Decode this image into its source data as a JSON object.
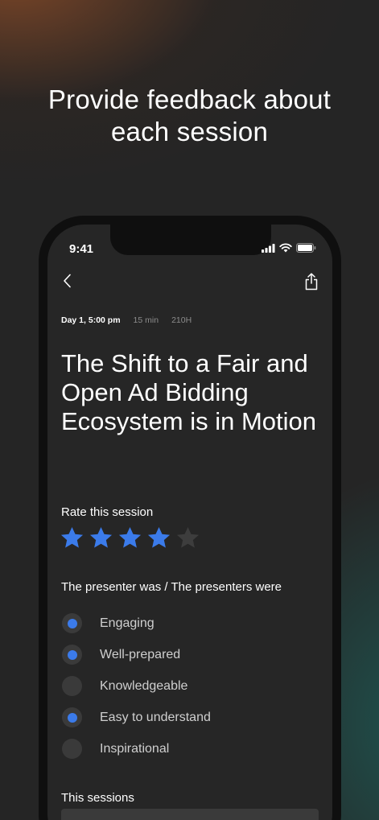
{
  "headline": {
    "line1": "Provide feedback about",
    "line2": "each session"
  },
  "status_bar": {
    "time": "9:41",
    "icons": [
      "cellular-signal-icon",
      "wifi-icon",
      "battery-icon"
    ]
  },
  "nav": {
    "back_icon": "chevron-left-icon",
    "share_icon": "share-icon"
  },
  "session": {
    "date": "Day 1, 5:00 pm",
    "duration": "15 min",
    "room": "210H",
    "title": "The Shift to a Fair and Open Ad Bidding Ecosystem is in Motion"
  },
  "rating": {
    "label": "Rate this session",
    "value": 4,
    "max": 5,
    "active_color": "#3b7bea",
    "inactive_color": "#3d3d3d"
  },
  "presenter": {
    "label": "The presenter was / The presenters were",
    "options": [
      {
        "label": "Engaging",
        "selected": true
      },
      {
        "label": "Well-prepared",
        "selected": true
      },
      {
        "label": "Knowledgeable",
        "selected": false
      },
      {
        "label": "Easy to understand",
        "selected": true
      },
      {
        "label": "Inspirational",
        "selected": false
      }
    ]
  },
  "sessions_section": {
    "label": "This sessions"
  },
  "colors": {
    "accent": "#3b7bea",
    "background": "#262626"
  }
}
